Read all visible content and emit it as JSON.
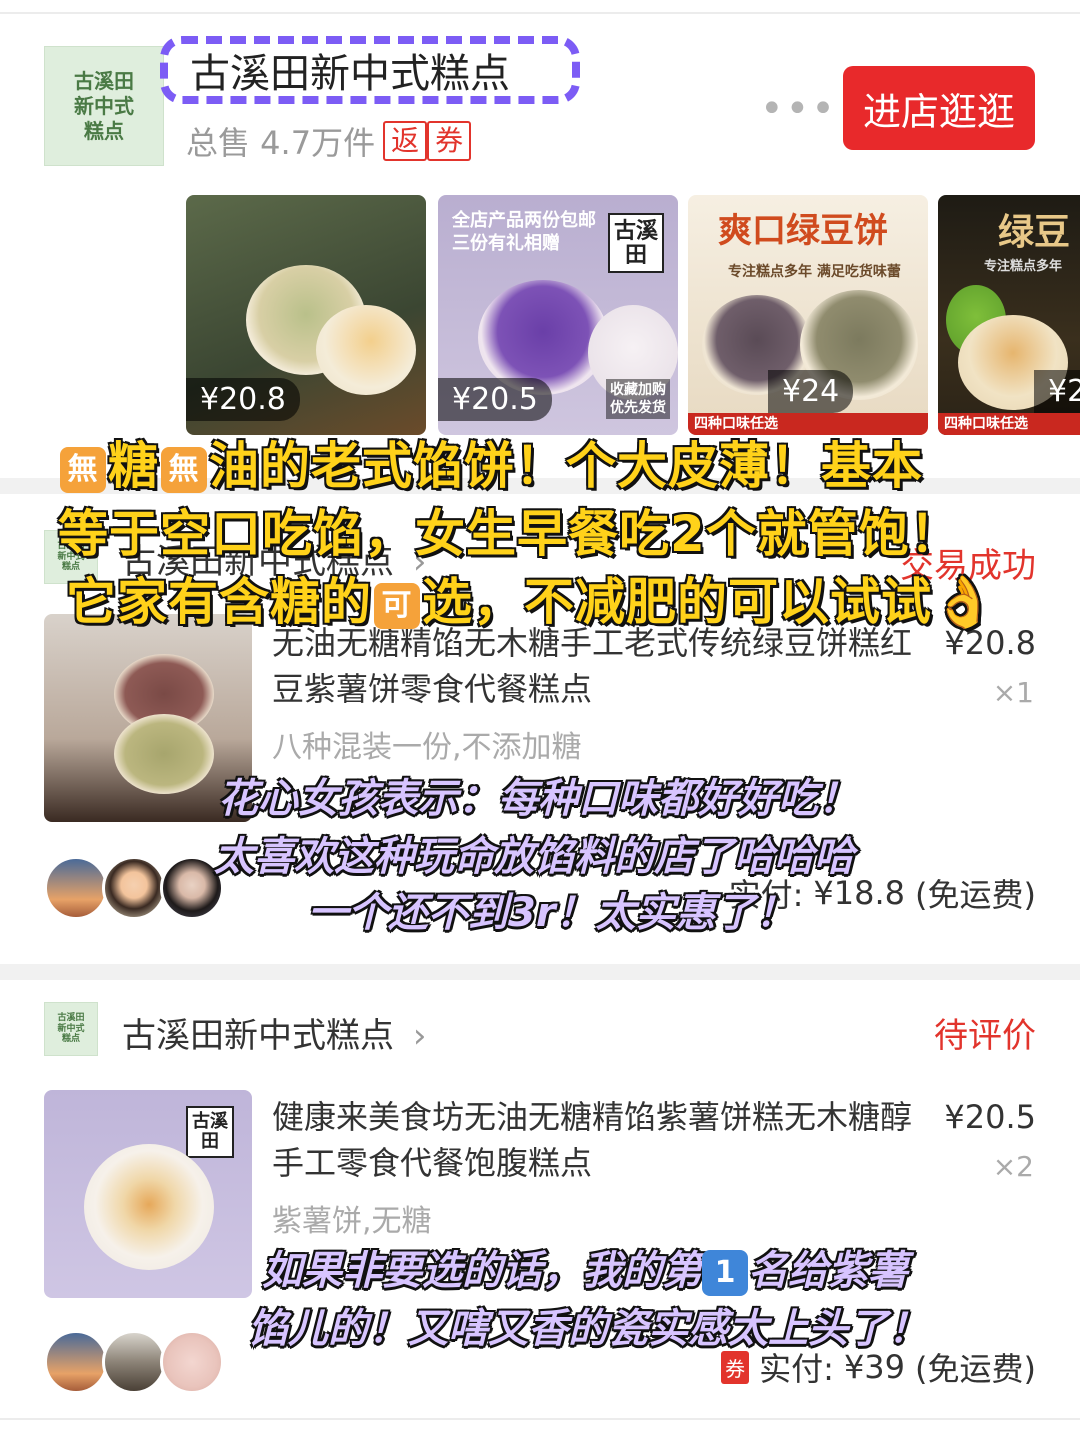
{
  "store": {
    "logo_text": "古溪田\n新中式\n糕点",
    "name": "古溪田新中式糕点",
    "sales": "总售 4.7万件",
    "tags": [
      "返",
      "券"
    ],
    "more": "•••",
    "visit_button": "进店逛逛"
  },
  "thumbnails": [
    {
      "price": "¥20.8"
    },
    {
      "price": "¥20.5",
      "caption": "全店产品两份包邮\n三份有礼相赠",
      "brand": "古溪\n田",
      "side_text": "收藏加购\n优先发货"
    },
    {
      "price": "¥24",
      "caption": "爽口绿豆饼",
      "sub": "专注糕点多年  满足吃货味蕾",
      "footer": "四种口味任选"
    },
    {
      "price": "¥2",
      "caption": "绿豆",
      "sub": "专注糕点多年",
      "footer": "四种口味任选"
    }
  ],
  "overlay_yellow": [
    {
      "pre": "",
      "e1": "無",
      "mid": "糖",
      "e2": "無",
      "post": "油的老式馅饼！个大皮薄！基本"
    },
    {
      "text": "等于空口吃馅，女生早餐吃2个就管饱！"
    },
    {
      "pre": "它家有含糖的",
      "e1": "可",
      "post": "选，不减肥的可以试试👌"
    }
  ],
  "orders": [
    {
      "shop": "古溪田新中式糕点",
      "status": "交易成功",
      "title": "无油无糖精馅无木糖手工老式传统绿豆饼糕红豆紫薯饼零食代餐糕点",
      "price": "¥20.8",
      "qty": "×1",
      "spec": "八种混装一份,不添加糖",
      "paid_label": "实付:",
      "paid_value": "¥18.8",
      "shipping": "(免运费)"
    },
    {
      "shop": "古溪田新中式糕点",
      "status": "待评价",
      "title": "健康来美食坊无油无糖精馅紫薯饼糕无木糖醇手工零食代餐饱腹糕点",
      "price": "¥20.5",
      "qty": "×2",
      "spec": "紫薯饼,无糖",
      "coupon": "券",
      "paid_label": "实付:",
      "paid_value": "¥39",
      "shipping": "(免运费)"
    }
  ],
  "overlay_purple_1": [
    "花心女孩表示：每种口味都好好吃！",
    "太喜欢这种玩命放馅料的店了哈哈哈",
    "一个还不到3r！太实惠了！"
  ],
  "overlay_purple_2": {
    "line1_pre": "如果非要选的话，我的第",
    "line1_emo": "1",
    "line1_post": "名给紫薯",
    "line2": "馅儿的！又嗐又香的瓷实感太上头了！"
  }
}
